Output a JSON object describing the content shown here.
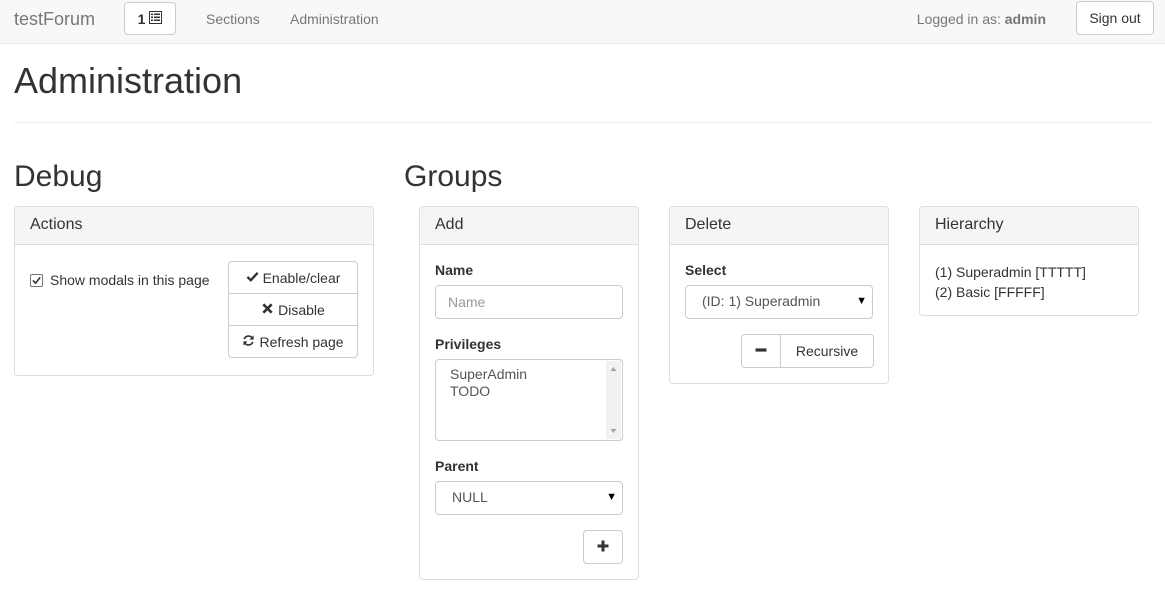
{
  "navbar": {
    "brand": "testForum",
    "notification_count": "1",
    "links": [
      "Sections",
      "Administration"
    ],
    "logged_in_prefix": "Logged in as:",
    "username": "admin",
    "signout_label": "Sign out"
  },
  "page": {
    "title": "Administration"
  },
  "debug": {
    "title": "Debug",
    "panel_title": "Actions",
    "checkbox_label": "Show modals in this page",
    "checkbox_checked": true,
    "buttons": [
      {
        "label": "Enable/clear",
        "icon": "check-icon"
      },
      {
        "label": "Disable",
        "icon": "times-icon"
      },
      {
        "label": "Refresh page",
        "icon": "refresh-icon"
      }
    ]
  },
  "groups": {
    "title": "Groups",
    "add": {
      "panel_title": "Add",
      "name_label": "Name",
      "name_placeholder": "Name",
      "privileges_label": "Privileges",
      "privileges_options": [
        "SuperAdmin",
        "TODO"
      ],
      "parent_label": "Parent",
      "parent_selected": "NULL",
      "add_icon": "plus-icon"
    },
    "delete": {
      "panel_title": "Delete",
      "select_label": "Select",
      "selected": "(ID: 1) Superadmin",
      "remove_icon": "minus-icon",
      "recursive_label": "Recursive"
    },
    "hierarchy": {
      "panel_title": "Hierarchy",
      "items": [
        "(1) Superadmin [TTTTT]",
        "(2) Basic [FFFFF]"
      ]
    }
  },
  "colors": {
    "navbar_bg": "#f8f8f8",
    "panel_heading_bg": "#f5f5f5",
    "border": "#dddddd",
    "text": "#333333",
    "muted_text": "#777777"
  }
}
